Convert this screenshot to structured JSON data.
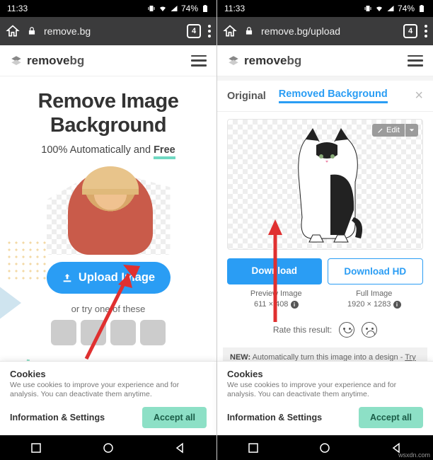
{
  "status": {
    "time": "11:33",
    "battery": "74%"
  },
  "chrome": {
    "tab_count": "4",
    "url_left": "remove.bg",
    "url_right": "remove.bg/upload"
  },
  "site": {
    "brand_bold": "remove",
    "brand_light": "bg"
  },
  "left": {
    "headline_l1": "Remove Image",
    "headline_l2": "Background",
    "sub_pre": "100% Automatically and ",
    "sub_free": "Free",
    "upload_label": "Upload Image",
    "try_pre": "or try one of these"
  },
  "right": {
    "tab_original": "Original",
    "tab_removed": "Removed Background",
    "edit_label": "Edit",
    "download": "Download",
    "download_hd": "Download HD",
    "preview_title": "Preview Image",
    "preview_dim": "611 × 408",
    "full_title": "Full Image",
    "full_dim": "1920 × 1283",
    "rate_label": "Rate this result:",
    "new_badge": "NEW:",
    "new_text": " Automatically turn this image into a design - ",
    "new_try": "Try now"
  },
  "cookie": {
    "title": "Cookies",
    "text": "We use cookies to improve your experience and for analysis. You can deactivate them anytime.",
    "info": "Information & Settings",
    "accept": "Accept all"
  },
  "watermark": "wsxdn.com"
}
